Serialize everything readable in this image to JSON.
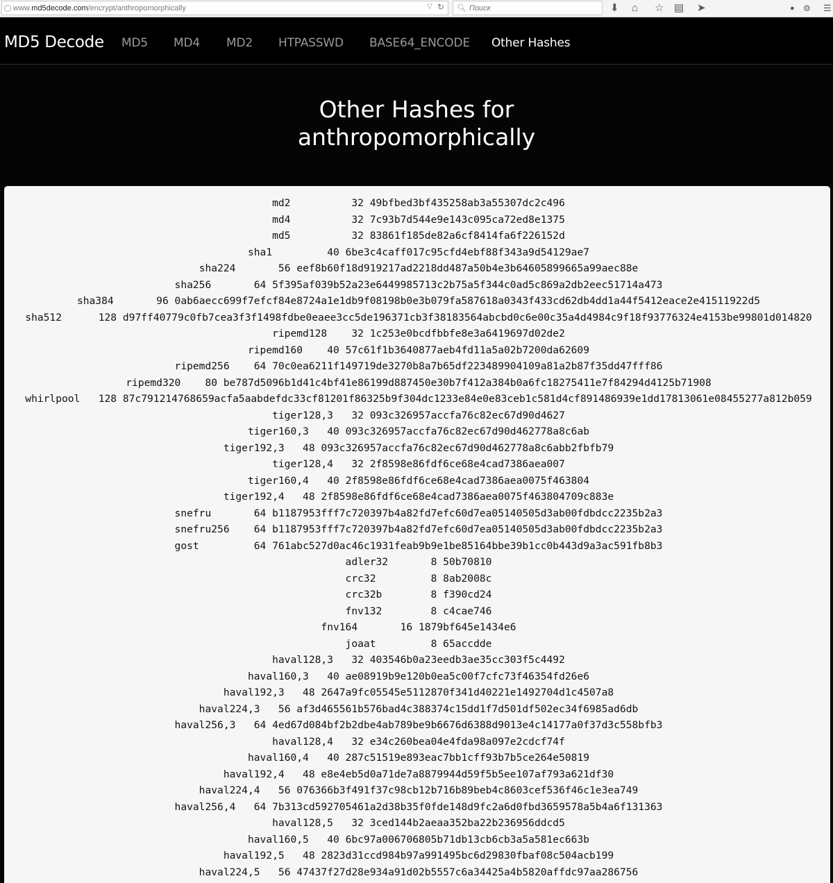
{
  "browser": {
    "url_prefix": "www.",
    "url_domain": "md5decode.com",
    "url_path": "/encrypt/anthropomorphically",
    "search_placeholder": "Поиск"
  },
  "nav": {
    "brand": "MD5 Decode",
    "links": [
      "MD5",
      "MD4",
      "MD2",
      "HTPASSWD",
      "BASE64_ENCODE",
      "Other Hashes"
    ],
    "active": "Other Hashes"
  },
  "hero": {
    "title_line1": "Other Hashes for",
    "title_line2": "anthropomorphically"
  },
  "hashes": [
    {
      "algo": "md2",
      "len": "32",
      "hash": "49bfbed3bf435258ab3a55307dc2c496"
    },
    {
      "algo": "md4",
      "len": "32",
      "hash": "7c93b7d544e9e143c095ca72ed8e1375"
    },
    {
      "algo": "md5",
      "len": "32",
      "hash": "83861f185de82a6cf8414fa6f226152d"
    },
    {
      "algo": "sha1",
      "len": "40",
      "hash": "6be3c4caff017c95cfd4ebf88f343a9d54129ae7"
    },
    {
      "algo": "sha224",
      "len": "56",
      "hash": "eef8b60f18d919217ad2218dd487a50b4e3b64605899665a99aec88e"
    },
    {
      "algo": "sha256",
      "len": "64",
      "hash": "5f395af039b52a23e6449985713c2b75a5f344c0ad5c869a2db2eec51714a473"
    },
    {
      "algo": "sha384",
      "len": "96",
      "hash": "0ab6aecc699f7efcf84e8724a1e1db9f08198b0e3b079fa587618a0343f433cd62db4dd1a44f5412eace2e41511922d5"
    },
    {
      "algo": "sha512",
      "len": "128",
      "hash": "d97ff40779c0fb7cea3f3f1498fdbe0eaee3cc5de196371cb3f38183564abcbd0c6e00c35a4d4984c9f18f93776324e4153be99801d014820"
    },
    {
      "algo": "ripemd128",
      "len": "32",
      "hash": "1c253e0bcdfbbfe8e3a6419697d02de2"
    },
    {
      "algo": "ripemd160",
      "len": "40",
      "hash": "57c61f1b3640877aeb4fd11a5a02b7200da62609"
    },
    {
      "algo": "ripemd256",
      "len": "64",
      "hash": "70c0ea6211f149719de3270b8a7b65df223489904109a81a2b87f35dd47fff86"
    },
    {
      "algo": "ripemd320",
      "len": "80",
      "hash": "be787d5096b1d41c4bf41e86199d887450e30b7f412a384b0a6fc18275411e7f84294d4125b71908"
    },
    {
      "algo": "whirlpool",
      "len": "128",
      "hash": "87c791214768659acfa5aabdefdc33cf81201f86325b9f304dc1233e84e0e83ceb1c581d4cf891486939e1dd17813061e08455277a812b059"
    },
    {
      "algo": "tiger128,3",
      "len": "32",
      "hash": "093c326957accfa76c82ec67d90d4627"
    },
    {
      "algo": "tiger160,3",
      "len": "40",
      "hash": "093c326957accfa76c82ec67d90d462778a8c6ab"
    },
    {
      "algo": "tiger192,3",
      "len": "48",
      "hash": "093c326957accfa76c82ec67d90d462778a8c6abb2fbfb79"
    },
    {
      "algo": "tiger128,4",
      "len": "32",
      "hash": "2f8598e86fdf6ce68e4cad7386aea007"
    },
    {
      "algo": "tiger160,4",
      "len": "40",
      "hash": "2f8598e86fdf6ce68e4cad7386aea0075f463804"
    },
    {
      "algo": "tiger192,4",
      "len": "48",
      "hash": "2f8598e86fdf6ce68e4cad7386aea0075f463804709c883e"
    },
    {
      "algo": "snefru",
      "len": "64",
      "hash": "b1187953fff7c720397b4a82fd7efc60d7ea05140505d3ab00fdbdcc2235b2a3"
    },
    {
      "algo": "snefru256",
      "len": "64",
      "hash": "b1187953fff7c720397b4a82fd7efc60d7ea05140505d3ab00fdbdcc2235b2a3"
    },
    {
      "algo": "gost",
      "len": "64",
      "hash": "761abc527d0ac46c1931feab9b9e1be85164bbe39b1cc0b443d9a3ac591fb8b3"
    },
    {
      "algo": "adler32",
      "len": "8",
      "hash": "50b70810"
    },
    {
      "algo": "crc32",
      "len": "8",
      "hash": "8ab2008c"
    },
    {
      "algo": "crc32b",
      "len": "8",
      "hash": "f390cd24"
    },
    {
      "algo": "fnv132",
      "len": "8",
      "hash": "c4cae746"
    },
    {
      "algo": "fnv164",
      "len": "16",
      "hash": "1879bf645e1434e6"
    },
    {
      "algo": "joaat",
      "len": "8",
      "hash": "65accdde"
    },
    {
      "algo": "haval128,3",
      "len": "32",
      "hash": "403546b0a23eedb3ae35cc303f5c4492"
    },
    {
      "algo": "haval160,3",
      "len": "40",
      "hash": "ae08919b9e120b0ea5c00f7cfc73f46354fd26e6"
    },
    {
      "algo": "haval192,3",
      "len": "48",
      "hash": "2647a9fc05545e5112870f341d40221e1492704d1c4507a8"
    },
    {
      "algo": "haval224,3",
      "len": "56",
      "hash": "af3d465561b576bad4c388374c15dd1f7d501df502ec34f6985ad6db"
    },
    {
      "algo": "haval256,3",
      "len": "64",
      "hash": "4ed67d084bf2b2dbe4ab789be9b6676d6388d9013e4c14177a0f37d3c558bfb3"
    },
    {
      "algo": "haval128,4",
      "len": "32",
      "hash": "e34c260bea04e4fda98a097e2cdcf74f"
    },
    {
      "algo": "haval160,4",
      "len": "40",
      "hash": "287c51519e893eac7bb1cff93b7b5ce264e50819"
    },
    {
      "algo": "haval192,4",
      "len": "48",
      "hash": "e8e4eb5d0a71de7a8879944d59f5b5ee107af793a621df30"
    },
    {
      "algo": "haval224,4",
      "len": "56",
      "hash": "076366b3f491f37c98cb12b716b89beb4c8603cef536f46c1e3ea749"
    },
    {
      "algo": "haval256,4",
      "len": "64",
      "hash": "7b313cd592705461a2d38b35f0fde148d9fc2a6d0fbd3659578a5b4a6f131363"
    },
    {
      "algo": "haval128,5",
      "len": "32",
      "hash": "3ced144b2aeaa352ba22b236956ddcd5"
    },
    {
      "algo": "haval160,5",
      "len": "40",
      "hash": "6bc97a006706805b71db13cb6cb3a5a581ec663b"
    },
    {
      "algo": "haval192,5",
      "len": "48",
      "hash": "2823d31ccd984b97a991495bc6d29830fbaf08c504acb199"
    },
    {
      "algo": "haval224,5",
      "len": "56",
      "hash": "47437f27d28e934a91d02b5557c6a34425a4b5820affdc97aa286756"
    }
  ]
}
